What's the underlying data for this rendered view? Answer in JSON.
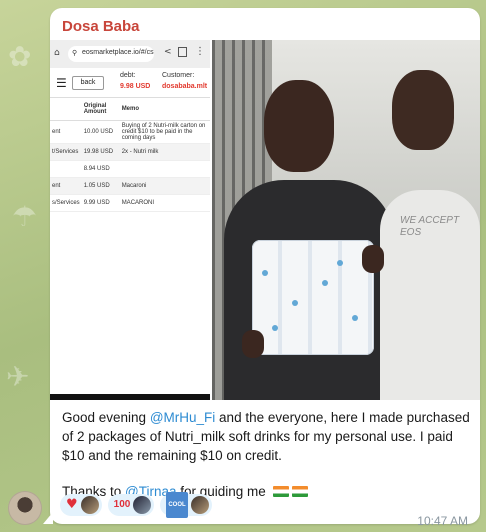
{
  "message": {
    "sender": "Dosa Baba",
    "caption_parts": [
      {
        "text": "Good evening ",
        "mention": false
      },
      {
        "text": "@MrHu_Fi",
        "mention": true
      },
      {
        "text": " and the everyone, here I made purchased of 2 packages of Nutri_milk soft drinks for my personal use. I paid $10 and the remaining $10 on credit.",
        "mention": false
      }
    ],
    "thanks_prefix": "Thanks to ",
    "thanks_mention": "@Tirnaa",
    "thanks_suffix": " for guiding me",
    "time": "10:47 AM"
  },
  "screenshot": {
    "url": "eosmarketplace.io/#/cs",
    "back_label": "back",
    "debt_label": "debt:",
    "debt_value": "9.98 USD",
    "customer_label": "Customer:",
    "customer_value": "dosababa.mlt",
    "columns": [
      "",
      "Original Amount",
      "Memo"
    ],
    "rows": [
      [
        "ent",
        "10.00 USD",
        "Buying of 2 Nutri-milk carton on credit $10 to be paid in the coming days"
      ],
      [
        "t/Services",
        "19.98 USD",
        "2x - Nutri milk"
      ],
      [
        "",
        "8.94 USD",
        ""
      ],
      [
        "ent",
        "1.05 USD",
        "Macaroni"
      ],
      [
        "s/Services",
        "9.99 USD",
        "MACARONI"
      ]
    ]
  },
  "photo": {
    "shirt_text": "WE ACCEPT EOS"
  },
  "reactions": [
    {
      "emoji": "heart-icon",
      "glyph": "♥"
    },
    {
      "emoji": "hundred-icon",
      "glyph": "100"
    },
    {
      "emoji": "cool-icon",
      "glyph": "COOL"
    }
  ],
  "colors": {
    "sender_name": "#c8463b",
    "mention": "#2d8bd2",
    "time": "#8a97a0",
    "reaction_pill": "#e3f2fc",
    "debt_value": "#e23a2f"
  }
}
